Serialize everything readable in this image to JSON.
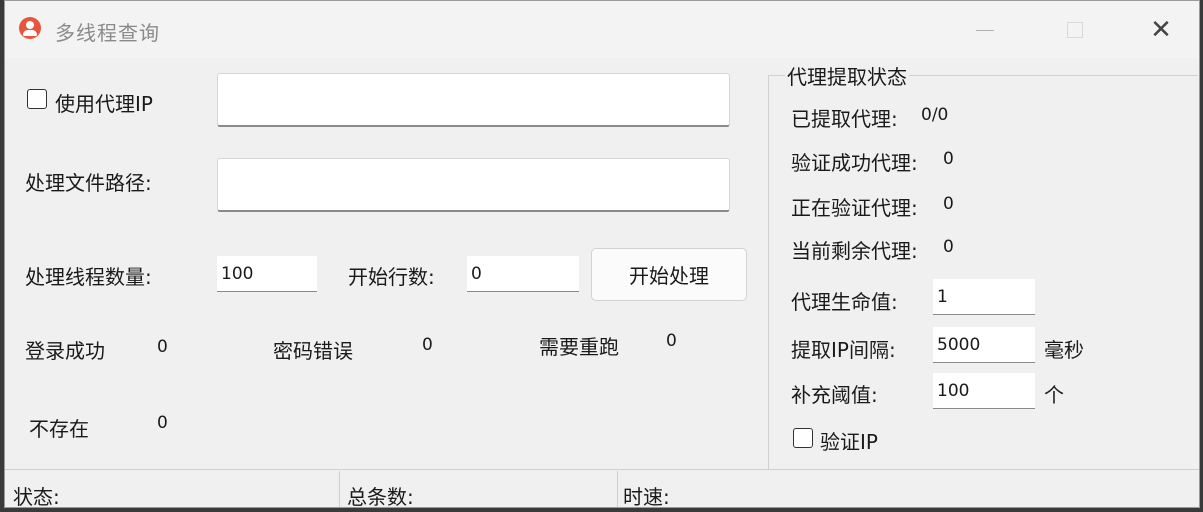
{
  "window": {
    "title": "多线程查询"
  },
  "form": {
    "use_proxy_label": "使用代理IP",
    "proxy_value": "",
    "file_path_label": "处理文件路径:",
    "file_path_value": "",
    "thread_count_label": "处理线程数量:",
    "thread_count_value": "100",
    "start_row_label": "开始行数:",
    "start_row_value": "0",
    "start_button": "开始处理"
  },
  "stats": {
    "login_success_label": "登录成功",
    "login_success_value": "0",
    "wrong_password_label": "密码错误",
    "wrong_password_value": "0",
    "rerun_label": "需要重跑",
    "rerun_value": "0",
    "not_exist_label": "不存在",
    "not_exist_value": "0"
  },
  "proxy_status": {
    "title": "代理提取状态",
    "extracted_label": "已提取代理:",
    "extracted_value": "0/0",
    "verified_label": "验证成功代理:",
    "verified_value": "0",
    "verifying_label": "正在验证代理:",
    "verifying_value": "0",
    "remaining_label": "当前剩余代理:",
    "remaining_value": "0",
    "life_label": "代理生命值:",
    "life_value": "1",
    "interval_label": "提取IP间隔:",
    "interval_value": "5000",
    "interval_unit": "毫秒",
    "threshold_label": "补充阈值:",
    "threshold_value": "100",
    "threshold_unit": "个",
    "verify_ip_label": "验证IP"
  },
  "statusbar": {
    "status_label": "状态:",
    "total_label": "总条数:",
    "speed_label": "时速:"
  }
}
